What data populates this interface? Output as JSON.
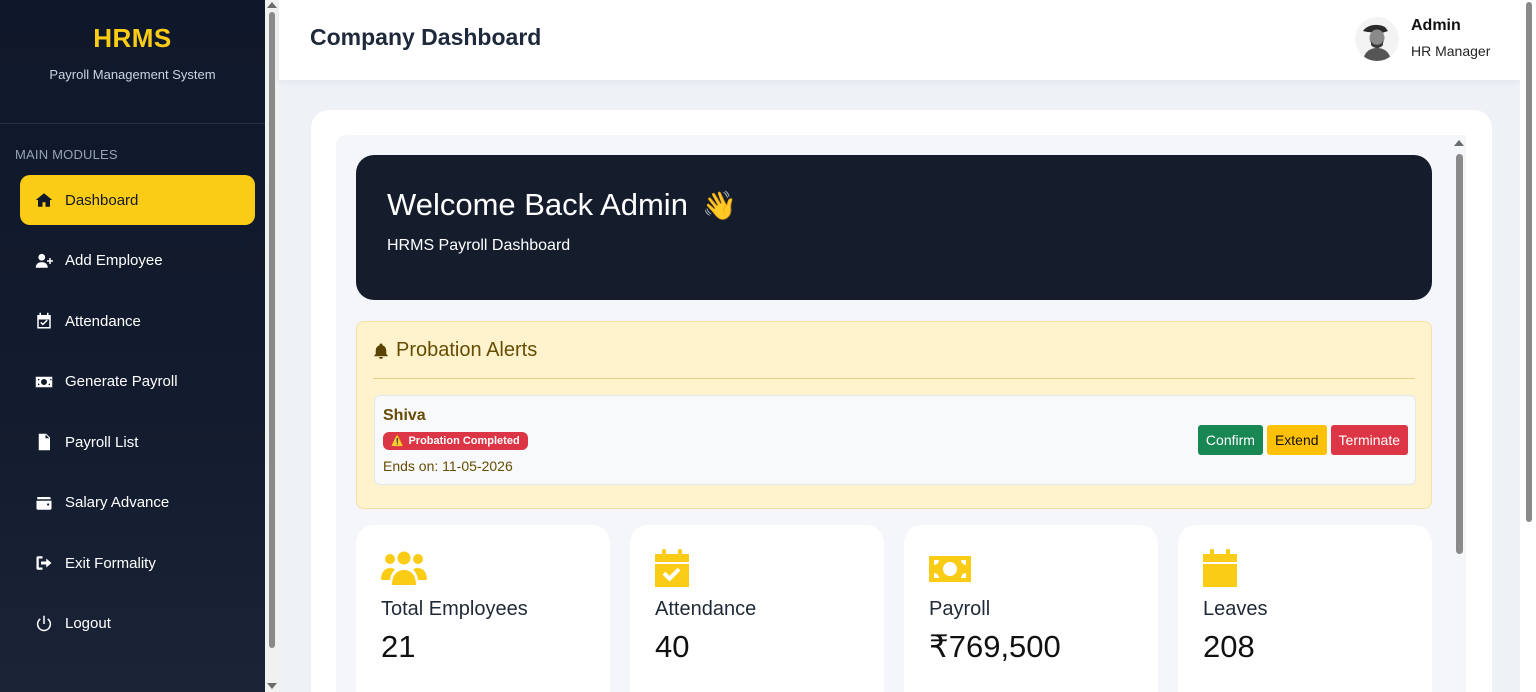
{
  "sidebar": {
    "brand": "HRMS",
    "subtitle": "Payroll Management System",
    "section_label": "MAIN MODULES",
    "items": [
      {
        "label": "Dashboard",
        "icon": "home-icon",
        "active": true
      },
      {
        "label": "Add Employee",
        "icon": "user-plus-icon"
      },
      {
        "label": "Attendance",
        "icon": "calendar-check-icon"
      },
      {
        "label": "Generate Payroll",
        "icon": "money-bill-icon"
      },
      {
        "label": "Payroll List",
        "icon": "file-invoice-icon"
      },
      {
        "label": "Salary Advance",
        "icon": "wallet-icon"
      },
      {
        "label": "Exit Formality",
        "icon": "sign-out-icon"
      },
      {
        "label": "Logout",
        "icon": "power-icon"
      }
    ]
  },
  "header": {
    "title": "Company Dashboard",
    "user": {
      "name": "Admin",
      "role": "HR Manager"
    }
  },
  "welcome": {
    "title": "Welcome Back Admin",
    "emoji": "👋",
    "subtitle": "HRMS Payroll Dashboard"
  },
  "probation": {
    "title": "Probation Alerts",
    "employee": {
      "name": "Shiva",
      "status": "Probation Completed",
      "ends_on": "Ends on: 11-05-2026"
    },
    "actions": {
      "confirm": "Confirm",
      "extend": "Extend",
      "terminate": "Terminate"
    }
  },
  "stats": [
    {
      "label": "Total Employees",
      "value": "21",
      "icon": "users-icon"
    },
    {
      "label": "Attendance",
      "value": "40",
      "icon": "calendar-check-icon"
    },
    {
      "label": "Payroll",
      "value": "₹769,500",
      "icon": "money-bill-icon"
    },
    {
      "label": "Leaves",
      "value": "208",
      "icon": "calendar-icon"
    }
  ],
  "colors": {
    "sidebar_bg": "#0f172a",
    "accent": "#facc15",
    "welcome_bg": "#151c2c",
    "alert_bg": "#fff3cd",
    "success": "#198754",
    "warning": "#ffc107",
    "danger": "#dc3545"
  }
}
